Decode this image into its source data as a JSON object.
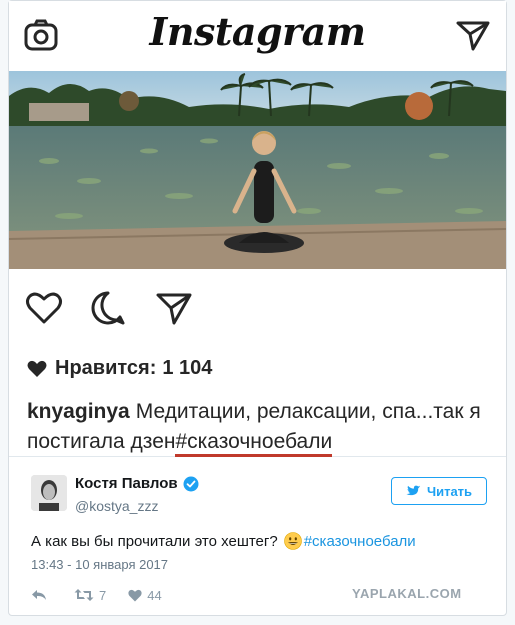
{
  "instagram": {
    "logo_text": "Instagram",
    "likes_label": "Нравится:",
    "likes_count": "1 104",
    "caption_user": "knyaginya",
    "caption_text": "Медитации, релаксации, спа...так я постигала дзен",
    "caption_hashtag": "#сказочноебали"
  },
  "tweet": {
    "author_name": "Костя Павлов",
    "author_handle": "@kostya_zzz",
    "follow_label": "Читать",
    "text": "А как вы бы прочитали это хештег?",
    "hashtag": "#сказочноебали",
    "timestamp": "13:43 - 10 января 2017",
    "retweet_count": "7",
    "like_count": "44"
  },
  "watermark": "YAPLAKAL.COM",
  "colors": {
    "twitter_blue": "#1da1f2",
    "hashtag_blue": "#1b95e0",
    "underline_red": "#c0392b",
    "muted_gray": "#657786"
  }
}
